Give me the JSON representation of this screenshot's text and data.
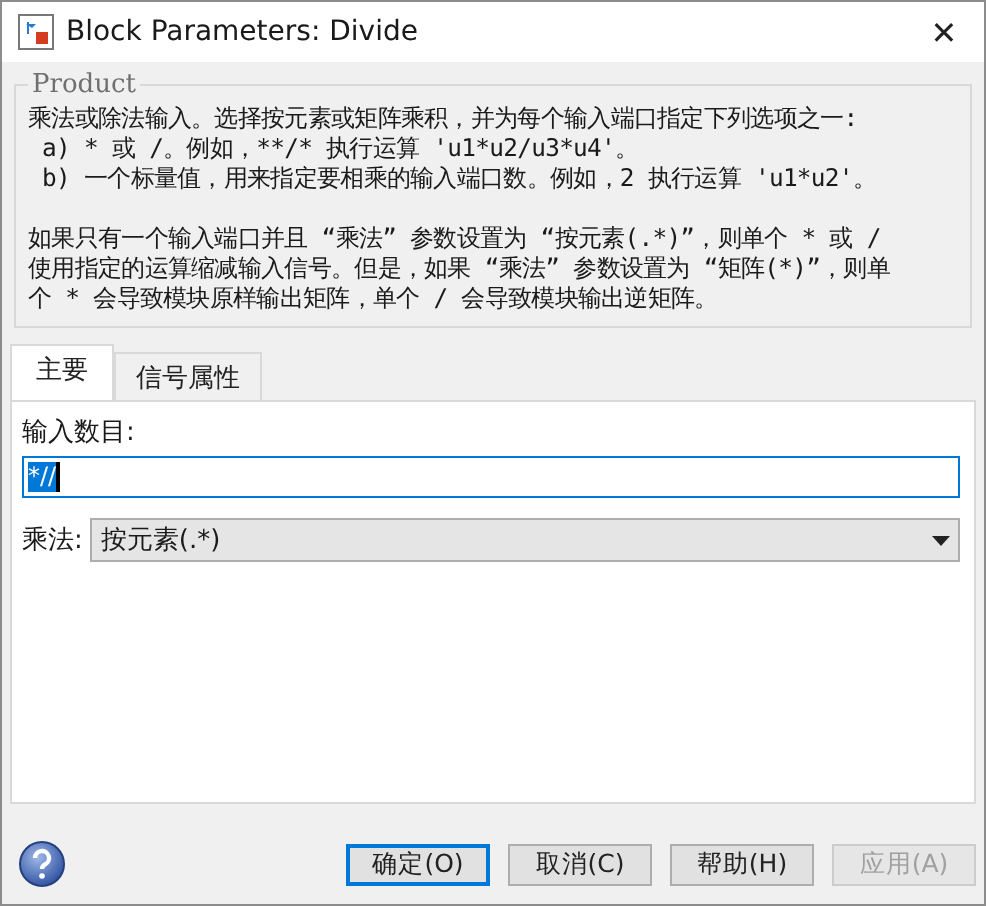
{
  "window": {
    "title": "Block Parameters: Divide",
    "close": "✕"
  },
  "group": {
    "title": "Product",
    "paragraphs": [
      [
        "乘法或除法输入。选择按元素或矩阵乘积，并为每个输入端口指定下列选项之一:",
        " a) * 或 /。例如，**/* 执行运算 'u1*u2/u3*u4'。",
        " b) 一个标量值，用来指定要相乘的输入端口数。例如，2 执行运算 'u1*u2'。"
      ],
      [
        "如果只有一个输入端口并且 “乘法” 参数设置为 “按元素(.*)”，则单个 * 或 /",
        "使用指定的运算缩减输入信号。但是，如果 “乘法” 参数设置为 “矩阵(*)”，则单",
        "个 * 会导致模块原样输出矩阵，单个 / 会导致模块输出逆矩阵。"
      ]
    ]
  },
  "tabs": [
    {
      "label": "主要",
      "selected": true
    },
    {
      "label": "信号属性",
      "selected": false
    }
  ],
  "inputs": {
    "label": "输入数目:",
    "value": "*//"
  },
  "multiplication": {
    "label": "乘法:",
    "value": "按元素(.*)"
  },
  "buttons": [
    {
      "label": "确定(O)",
      "default": true,
      "disabled": false
    },
    {
      "label": "取消(C)",
      "default": false,
      "disabled": false
    },
    {
      "label": "帮助(H)",
      "default": false,
      "disabled": false
    },
    {
      "label": "应用(A)",
      "default": false,
      "disabled": true
    }
  ]
}
